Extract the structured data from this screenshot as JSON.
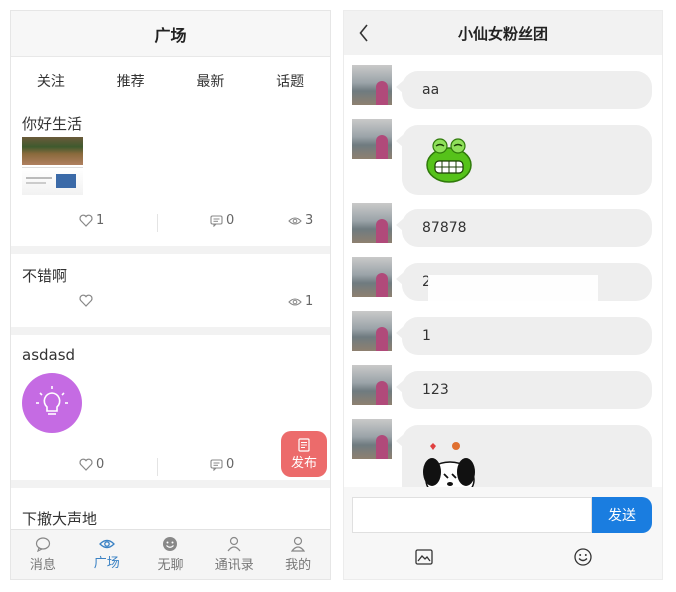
{
  "plaza": {
    "title": "广场",
    "tabs": [
      {
        "label": "关注"
      },
      {
        "label": "推荐",
        "active": true
      },
      {
        "label": "最新"
      },
      {
        "label": "话题"
      }
    ],
    "posts": [
      {
        "title": "你好生活",
        "likes": "1",
        "comments": "0",
        "views": "3"
      },
      {
        "title": "不错啊",
        "likes": "",
        "views": "1"
      },
      {
        "title": "asdasd",
        "likes": "0",
        "comments": "0"
      },
      {
        "title": "下撤大声地"
      }
    ],
    "publish_label": "发布",
    "tabbar": [
      {
        "label": "消息",
        "icon": "chat-bubble-icon"
      },
      {
        "label": "广场",
        "icon": "eye-icon",
        "active": true
      },
      {
        "label": "无聊",
        "icon": "smiley-icon"
      },
      {
        "label": "通讯录",
        "icon": "contacts-icon"
      },
      {
        "label": "我的",
        "icon": "user-icon"
      }
    ],
    "colors": {
      "accent": "#3b82c4",
      "tab_underline": "#e0b06a",
      "fab": "#ec6b6b",
      "bulb": "#c56be3"
    }
  },
  "chat": {
    "title": "小仙女粉丝团",
    "messages": [
      {
        "text": "aa"
      },
      {
        "type": "sticker",
        "sticker": "green-frog-sticker"
      },
      {
        "text": "87878"
      },
      {
        "text": "2"
      },
      {
        "text": "1"
      },
      {
        "text": "123"
      },
      {
        "type": "sticker",
        "sticker": "panda-sticker"
      }
    ],
    "input_placeholder": "",
    "send_label": "发送",
    "colors": {
      "send": "#1a7de0",
      "bubble": "#eeeeee"
    }
  }
}
